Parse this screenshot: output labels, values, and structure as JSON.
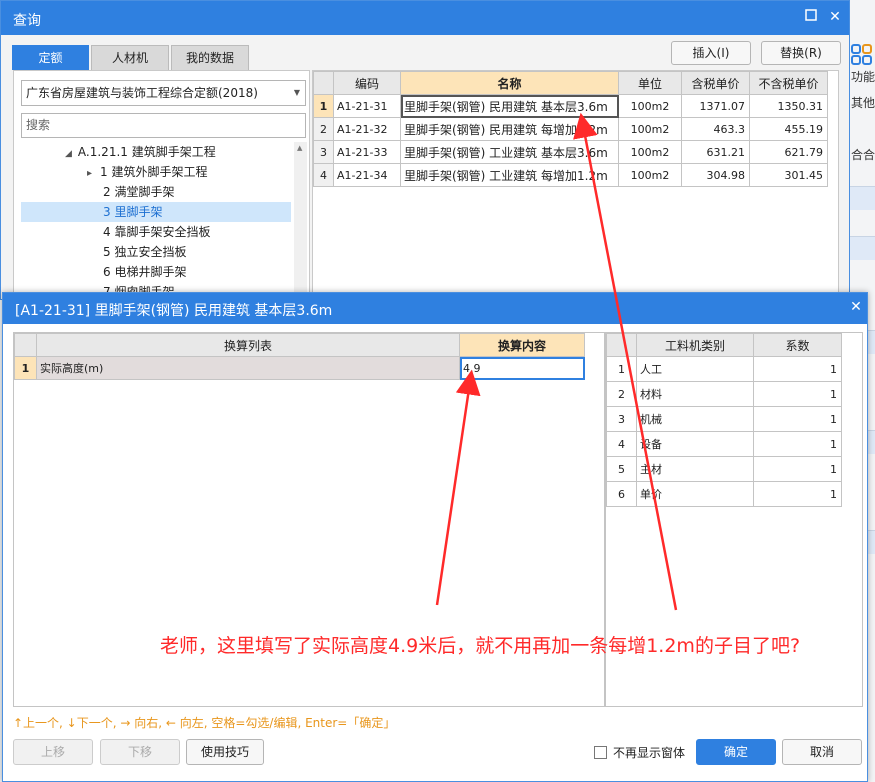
{
  "main_dialog": {
    "title": "查询",
    "tabs": [
      "定额",
      "人材机",
      "我的数据"
    ],
    "insert_label": "插入(I)",
    "replace_label": "替换(R)",
    "norm_select": "广东省房屋建筑与装饰工程综合定额(2018)",
    "search_placeholder": "搜索",
    "tree": [
      {
        "label": "A.1.21.1 建筑脚手架工程",
        "indicator": "◢"
      },
      {
        "label": "1 建筑外脚手架工程",
        "indicator": "▸"
      },
      {
        "label": "2 满堂脚手架",
        "indicator": ""
      },
      {
        "label": "3 里脚手架",
        "indicator": ""
      },
      {
        "label": "4 靠脚手架安全挡板",
        "indicator": ""
      },
      {
        "label": "5 独立安全挡板",
        "indicator": ""
      },
      {
        "label": "6 电梯井脚手架",
        "indicator": ""
      },
      {
        "label": "7 烟囱脚手架",
        "indicator": ""
      }
    ],
    "table": {
      "headers": [
        "编码",
        "名称",
        "单位",
        "含税单价",
        "不含税单价"
      ],
      "rows": [
        {
          "no": "1",
          "code": "A1-21-31",
          "name": "里脚手架(钢管) 民用建筑 基本层3.6m",
          "unit": "100m2",
          "price_tax": "1371.07",
          "price_notax": "1350.31"
        },
        {
          "no": "2",
          "code": "A1-21-32",
          "name": "里脚手架(钢管) 民用建筑 每增加1.2m",
          "unit": "100m2",
          "price_tax": "463.3",
          "price_notax": "455.19"
        },
        {
          "no": "3",
          "code": "A1-21-33",
          "name": "里脚手架(钢管) 工业建筑 基本层3.6m",
          "unit": "100m2",
          "price_tax": "631.21",
          "price_notax": "621.79"
        },
        {
          "no": "4",
          "code": "A1-21-34",
          "name": "里脚手架(钢管) 工业建筑 每增加1.2m",
          "unit": "100m2",
          "price_tax": "304.98",
          "price_notax": "301.45"
        }
      ]
    }
  },
  "sub_dialog": {
    "title": "[A1-21-31] 里脚手架(钢管) 民用建筑 基本层3.6m",
    "left_headers": [
      "换算列表",
      "换算内容"
    ],
    "left_rows": [
      {
        "no": "1",
        "name": "实际高度(m)",
        "value": "4.9"
      }
    ],
    "right_headers": [
      "工料机类别",
      "系数"
    ],
    "right_rows": [
      {
        "no": "1",
        "name": "人工",
        "value": "1"
      },
      {
        "no": "2",
        "name": "材料",
        "value": "1"
      },
      {
        "no": "3",
        "name": "机械",
        "value": "1"
      },
      {
        "no": "4",
        "name": "设备",
        "value": "1"
      },
      {
        "no": "5",
        "name": "主材",
        "value": "1"
      },
      {
        "no": "6",
        "name": "单价",
        "value": "1"
      }
    ],
    "hint": "↑上一个, ↓下一个, → 向右, ← 向左, 空格=勾选/编辑, Enter=「确定」",
    "move_up": "上移",
    "move_down": "下移",
    "tips": "使用技巧",
    "no_show": "不再显示窗体",
    "ok": "确定",
    "cancel": "取消"
  },
  "background": {
    "texts": [
      "功能",
      "其他",
      "合合"
    ]
  },
  "annotation": "老师，这里填写了实际高度4.9米后，就不用再加一条每增1.2m的子目了吧?",
  "colors": {
    "accent": "#2f80e0",
    "header_highlight": "#fde4b8",
    "annotation": "#ff2a2a"
  }
}
